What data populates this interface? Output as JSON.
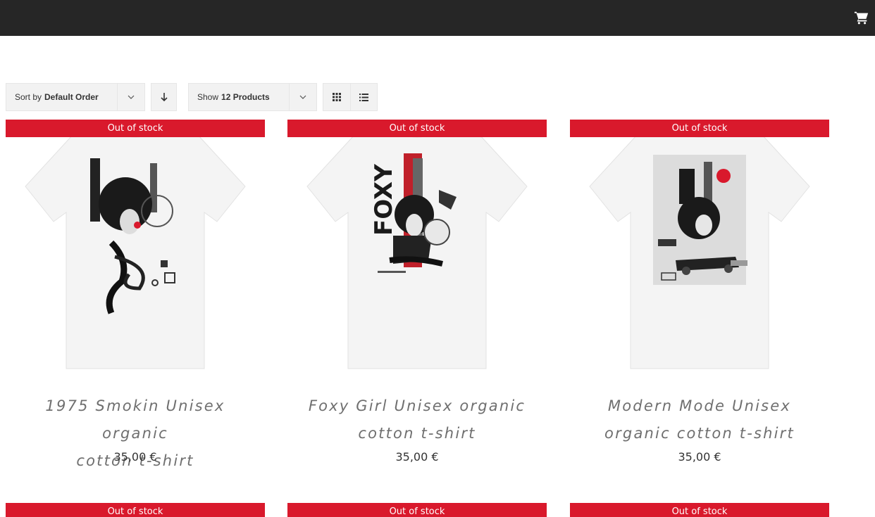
{
  "header": {
    "cart_icon": "shopping-cart-icon",
    "background": "#262626"
  },
  "toolbar": {
    "sort_prefix": "Sort by",
    "sort_value": "Default Order",
    "show_prefix": "Show",
    "show_value": "12 Products",
    "icons": [
      "chevron-down-icon",
      "sort-descending-icon",
      "grid-view-icon",
      "list-view-icon"
    ]
  },
  "accent_color": "#d9192c",
  "products": [
    {
      "badge": "Out of stock",
      "title_line1": "1975 Smokin Unisex organic",
      "title_line2": "cotton t-shirt",
      "price": "35,00 €"
    },
    {
      "badge": "Out of stock",
      "title_line1": "Foxy Girl Unisex organic",
      "title_line2": "cotton t-shirt",
      "price": "35,00 €"
    },
    {
      "badge": "Out of stock",
      "title_line1": "Modern Mode Unisex",
      "title_line2": "organic cotton t-shirt",
      "price": "35,00 €"
    },
    {
      "badge": "Out of stock"
    },
    {
      "badge": "Out of stock"
    },
    {
      "badge": "Out of stock"
    }
  ]
}
